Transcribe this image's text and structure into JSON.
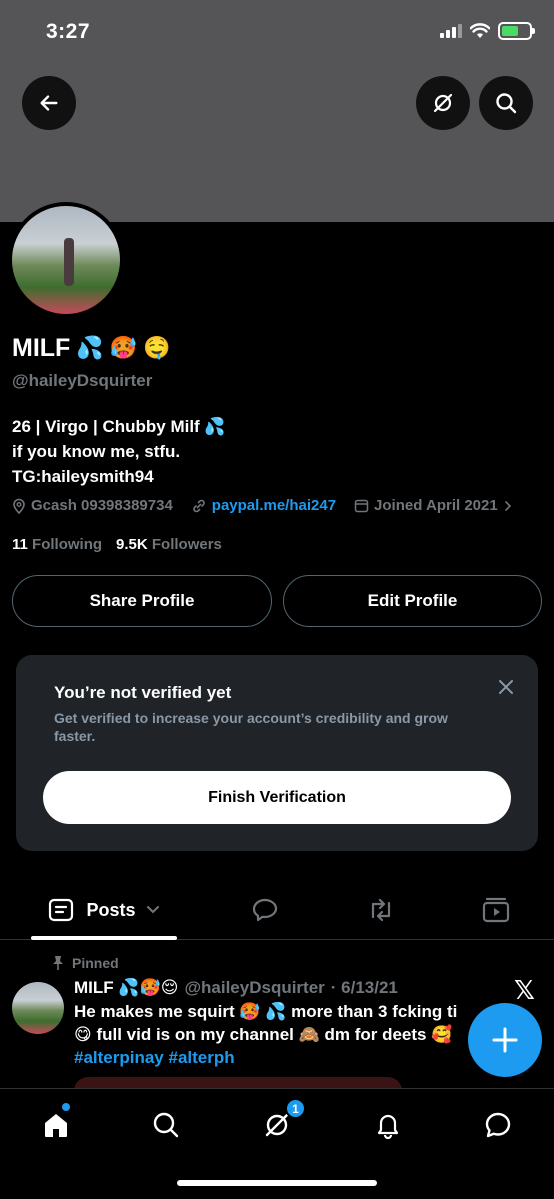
{
  "status_bar": {
    "time": "3:27"
  },
  "profile": {
    "display_name": "MILF",
    "name_emojis": [
      "💦",
      "🥵",
      "🤤"
    ],
    "handle": "@haileyDsquirter",
    "bio_lines": [
      "26 | Virgo | Chubby Milf 💦",
      "if you know me, stfu.",
      "TG:haileysmith94"
    ],
    "location": "Gcash 09398389734",
    "website": "paypal.me/hai247",
    "joined": "Joined April 2021",
    "following_count": "11",
    "following_label": "Following",
    "followers_count": "9.5K",
    "followers_label": "Followers"
  },
  "actions": {
    "share_label": "Share Profile",
    "edit_label": "Edit Profile"
  },
  "verify_card": {
    "title": "You’re not verified yet",
    "text": "Get verified to increase your account’s credibility and grow faster.",
    "button": "Finish Verification"
  },
  "tabs": {
    "posts_label": "Posts"
  },
  "post": {
    "pinned_label": "Pinned",
    "author_name": "MILF 💦🥵😌",
    "author_handle": "@haileyDsquirter",
    "date": "· 6/13/21",
    "line1": "He makes me squirt 🥵 💦 more than 3 fcking ti",
    "line2": "😋 full vid is on my channel 🙈 dm for deets 🥰",
    "hashtags": "#alterpinay #alterph"
  },
  "nav": {
    "messages_badge": "1"
  },
  "colors": {
    "accent": "#1d9bf0",
    "banner": "#555558",
    "card": "#202327"
  }
}
